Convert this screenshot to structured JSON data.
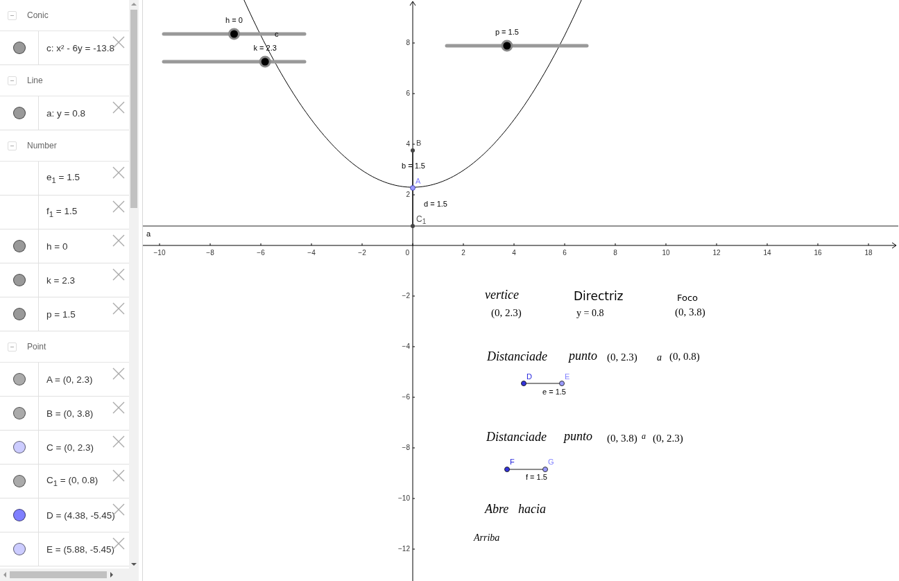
{
  "algebra": {
    "groups": [
      {
        "title": "Conic",
        "items": [
          {
            "text": "c: x² - 6y = -13.8",
            "color": "#999999"
          }
        ]
      },
      {
        "title": "Line",
        "items": [
          {
            "text": "a: y = 0.8",
            "color": "#999999"
          }
        ]
      },
      {
        "title": "Number",
        "items": [
          {
            "text": "e$_{1}$ = 1.5"
          },
          {
            "text": "f$_{1}$ = 1.5"
          },
          {
            "text": "h = 0",
            "color": "#999999"
          },
          {
            "text": "k = 2.3",
            "color": "#999999"
          },
          {
            "text": "p = 1.5",
            "color": "#999999"
          }
        ]
      },
      {
        "title": "Point",
        "items": [
          {
            "text": "A = (0, 2.3)",
            "color": "#aaaaaa"
          },
          {
            "text": "B = (0, 3.8)",
            "color": "#aaaaaa"
          },
          {
            "text": "C = (0, 2.3)",
            "color": "#ccccff"
          },
          {
            "text": "C$_{1}$ = (0, 0.8)",
            "color": "#aaaaaa"
          },
          {
            "text": "D = (4.38, -5.45)",
            "color": "#7f7fff"
          },
          {
            "text": "E = (5.88, -5.45)",
            "color": "#ccccff"
          }
        ]
      }
    ]
  },
  "graphics": {
    "x_ticks": [
      "−10",
      "−8",
      "−6",
      "−4",
      "−2",
      "0",
      "2",
      "4",
      "6",
      "8",
      "10",
      "12",
      "14",
      "16",
      "18"
    ],
    "y_ticks": [
      "8",
      "6",
      "4",
      "2",
      "−2",
      "−4",
      "−6",
      "−8",
      "−10",
      "−12"
    ],
    "sliders": [
      {
        "label": "h = 0",
        "level": 0.5
      },
      {
        "label": "k = 2.3",
        "level": 0.72
      },
      {
        "label": "p = 1.5",
        "level": 0.43
      }
    ],
    "labels": [
      {
        "text": "c"
      },
      {
        "text": "a"
      },
      {
        "text": "B",
        "color": "#444444"
      },
      {
        "text": "b = 1.5"
      },
      {
        "text": "A",
        "color": "#7f7fff"
      },
      {
        "text": "d = 1.5"
      },
      {
        "text": "C$_{1}$",
        "color": "#555555"
      },
      {
        "text": "D",
        "color": "#2222dd"
      },
      {
        "text": "E",
        "color": "#7f7fff"
      },
      {
        "text": "e = 1.5"
      },
      {
        "text": "F",
        "color": "#2222dd"
      },
      {
        "text": "G",
        "color": "#7f7fff"
      },
      {
        "text": "f = 1.5"
      }
    ],
    "texts": [
      {
        "text": "vertice",
        "kind": "math-word"
      },
      {
        "text": "(0, 2.3)",
        "kind": "math"
      },
      {
        "text": "Directriz",
        "kind": "plain"
      },
      {
        "text": "y = 0.8",
        "kind": "math"
      },
      {
        "text": "Foco",
        "kind": "plain"
      },
      {
        "text": "(0, 3.8)",
        "kind": "math"
      },
      {
        "text": "Distanciade",
        "kind": "math-word"
      },
      {
        "text": "punto",
        "kind": "math-word"
      },
      {
        "text": "(0, 2.3)",
        "kind": "math"
      },
      {
        "text": "a",
        "kind": "math-word"
      },
      {
        "text": "(0, 0.8)",
        "kind": "math"
      },
      {
        "text": "Distanciade",
        "kind": "math-word"
      },
      {
        "text": "punto",
        "kind": "math-word"
      },
      {
        "text": "(0, 3.8)",
        "kind": "math"
      },
      {
        "text": "a",
        "kind": "math-word"
      },
      {
        "text": "(0, 2.3)",
        "kind": "math"
      },
      {
        "text": "Abre",
        "kind": "math-word"
      },
      {
        "text": "hacia",
        "kind": "math-word"
      },
      {
        "text": "Arriba",
        "kind": "math-word"
      }
    ]
  }
}
